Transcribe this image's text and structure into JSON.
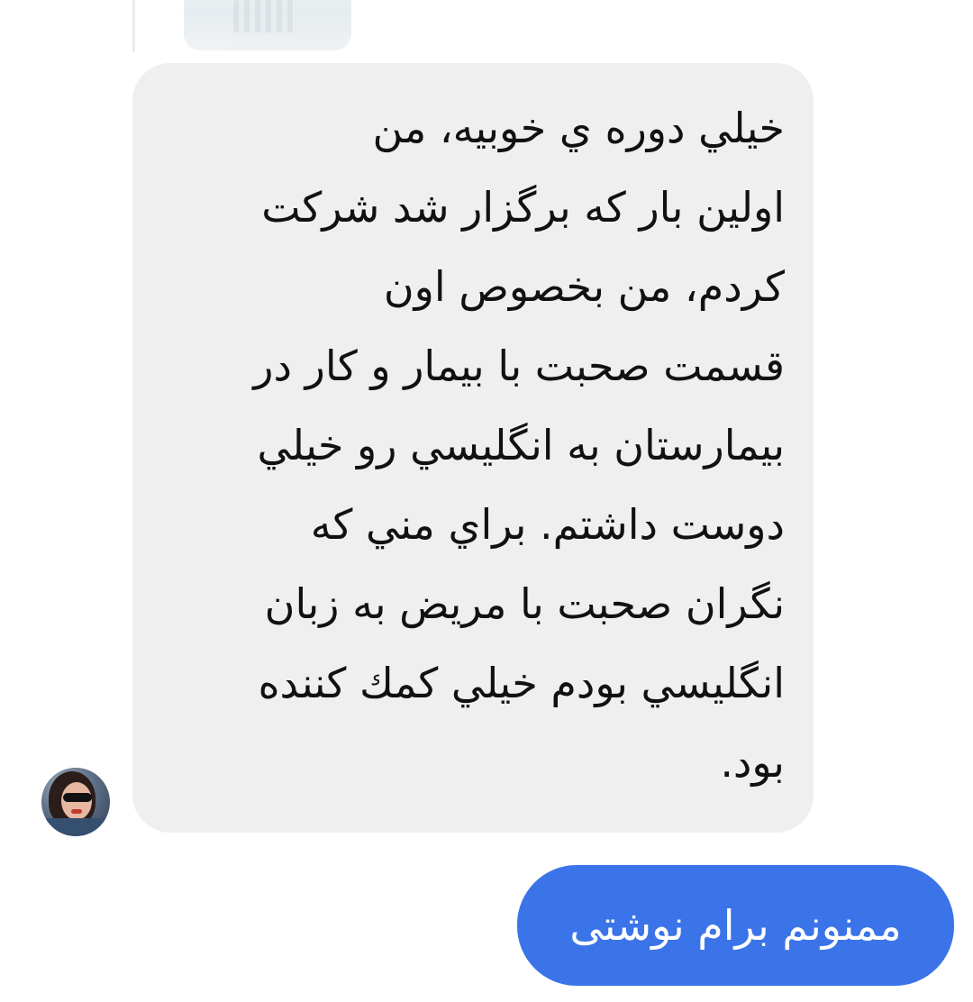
{
  "thread": {
    "incoming": {
      "text": "خيلي دوره ي خوبيه، من\nاولين بار که برگزار شد شرکت\nکردم، من بخصوص اون\nقسمت صحبت با بيمار و کار در\nبيمارستان به انگليسي رو خيلي\nدوست داشتم. براي مني كه\nنگران صحبت با مريض به زبان\nانگليسي بودم خيلي کمك كننده\nبود.",
      "avatar_icon": "profile-photo-avatar",
      "bubble_color": "#efefef"
    },
    "outgoing": {
      "text": "ممنونم برام نوشتی",
      "bubble_color": "#3a74e8"
    }
  }
}
